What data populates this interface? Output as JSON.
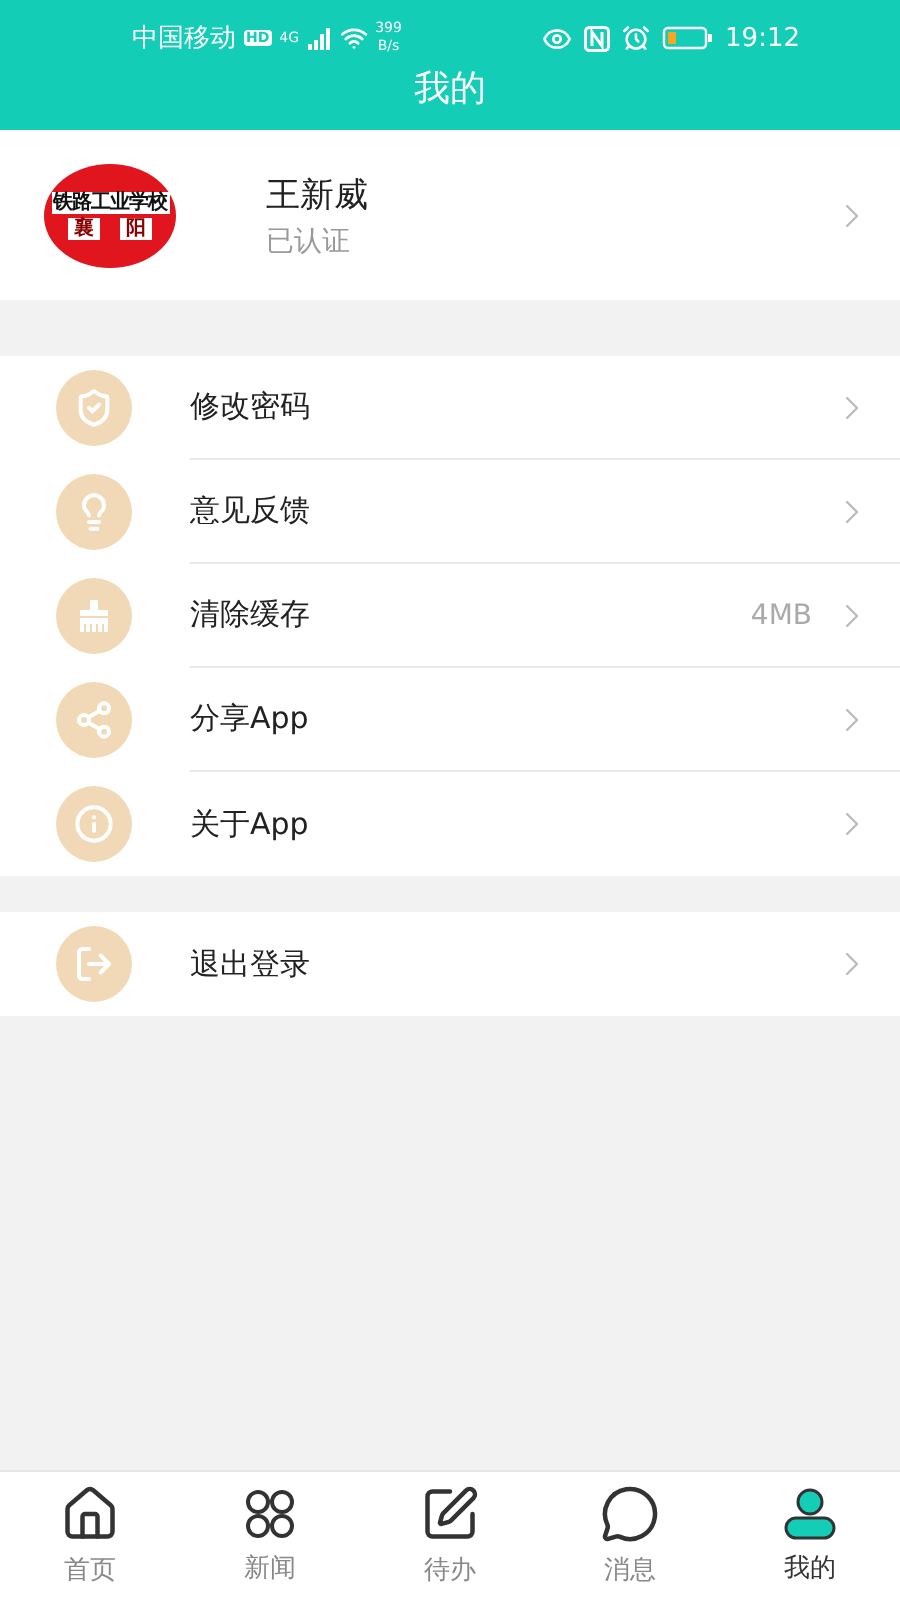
{
  "status_bar": {
    "carrier": "中国移动",
    "hd": "HD",
    "network": "4G",
    "speed_value": "399",
    "speed_unit": "B/s",
    "time": "19:12"
  },
  "header": {
    "title": "我的"
  },
  "profile": {
    "logo_top": "铁路工业学校",
    "logo_bottom": [
      "襄",
      "阳"
    ],
    "name": "王新威",
    "status": "已认证"
  },
  "menu_groups": [
    {
      "items": [
        {
          "label": "修改密码"
        },
        {
          "label": "意见反馈"
        },
        {
          "label": "清除缓存",
          "value": "4MB"
        },
        {
          "label": "分享App"
        },
        {
          "label": "关于App"
        }
      ]
    },
    {
      "items": [
        {
          "label": "退出登录"
        }
      ]
    }
  ],
  "tab_bar": [
    {
      "label": "首页",
      "selected": false
    },
    {
      "label": "新闻",
      "selected": false
    },
    {
      "label": "待办",
      "selected": false
    },
    {
      "label": "消息",
      "selected": false
    },
    {
      "label": "我的",
      "selected": true
    }
  ]
}
